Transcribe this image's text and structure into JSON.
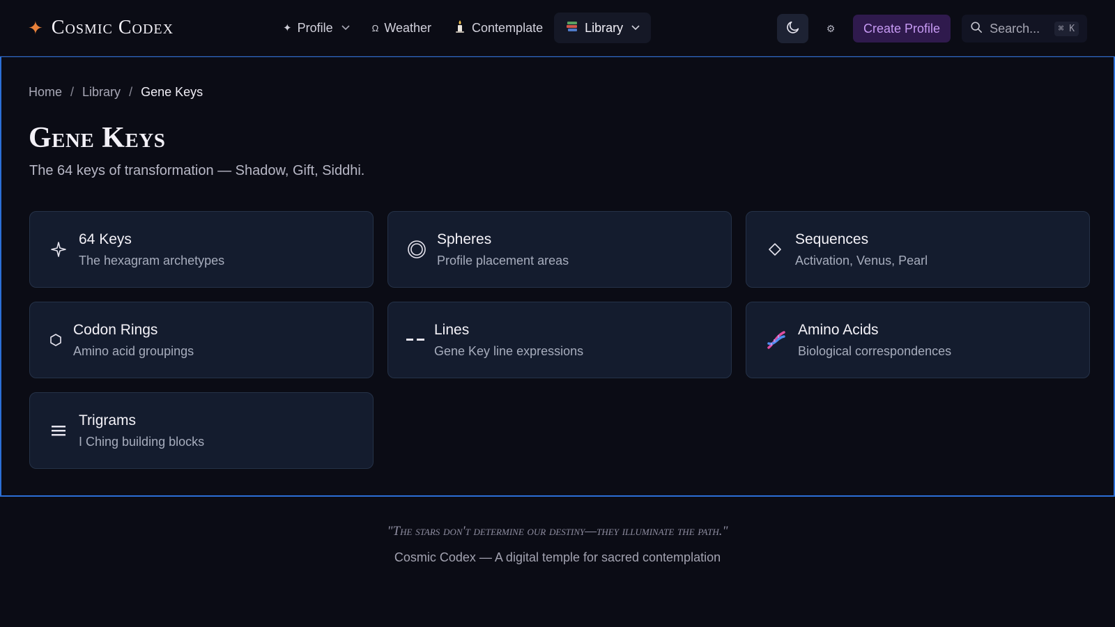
{
  "brand": {
    "name": "Cosmic Codex"
  },
  "nav": {
    "profile": "Profile",
    "weather": "Weather",
    "contemplate": "Contemplate",
    "library": "Library"
  },
  "actions": {
    "create_profile": "Create Profile",
    "search_placeholder": "Search...",
    "search_shortcut": "⌘ K"
  },
  "breadcrumb": {
    "home": "Home",
    "library": "Library",
    "current": "Gene Keys",
    "separator": "/"
  },
  "page": {
    "title": "Gene Keys",
    "subtitle": "The 64 keys of transformation — Shadow, Gift, Siddhi."
  },
  "cards": [
    {
      "title": "64 Keys",
      "desc": "The hexagram archetypes",
      "icon": "sparkle-icon"
    },
    {
      "title": "Spheres",
      "desc": "Profile placement areas",
      "icon": "sphere-icon"
    },
    {
      "title": "Sequences",
      "desc": "Activation, Venus, Pearl",
      "icon": "diamond-icon"
    },
    {
      "title": "Codon Rings",
      "desc": "Amino acid groupings",
      "icon": "hexagon-icon"
    },
    {
      "title": "Lines",
      "desc": "Gene Key line expressions",
      "icon": "broken-line-icon"
    },
    {
      "title": "Amino Acids",
      "desc": "Biological correspondences",
      "icon": "dna-icon"
    },
    {
      "title": "Trigrams",
      "desc": "I Ching building blocks",
      "icon": "trigram-icon"
    }
  ],
  "footer": {
    "quote": "\"The stars don't determine our destiny—they illuminate the path.\"",
    "tagline": "Cosmic Codex — A digital temple for sacred contemplation"
  },
  "colors": {
    "accent": "#e8813a",
    "highlight": "#2b6fd6",
    "create_bg": "#2f1a4d",
    "create_text": "#c79af4"
  }
}
